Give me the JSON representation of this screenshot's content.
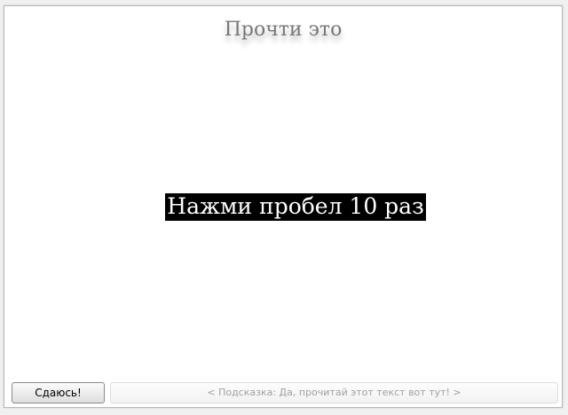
{
  "header": {
    "title": "Прочти это"
  },
  "main": {
    "instruction": "Нажми пробел 10 раз"
  },
  "footer": {
    "give_up_label": "Сдаюсь!",
    "hint_text": "< Подсказка: Да, прочитай этот текст вот тут! >"
  },
  "colors": {
    "instruction_background": "#000000",
    "instruction_text": "#ffffff",
    "title_text": "#777777",
    "hint_text": "#a0a0a0"
  }
}
